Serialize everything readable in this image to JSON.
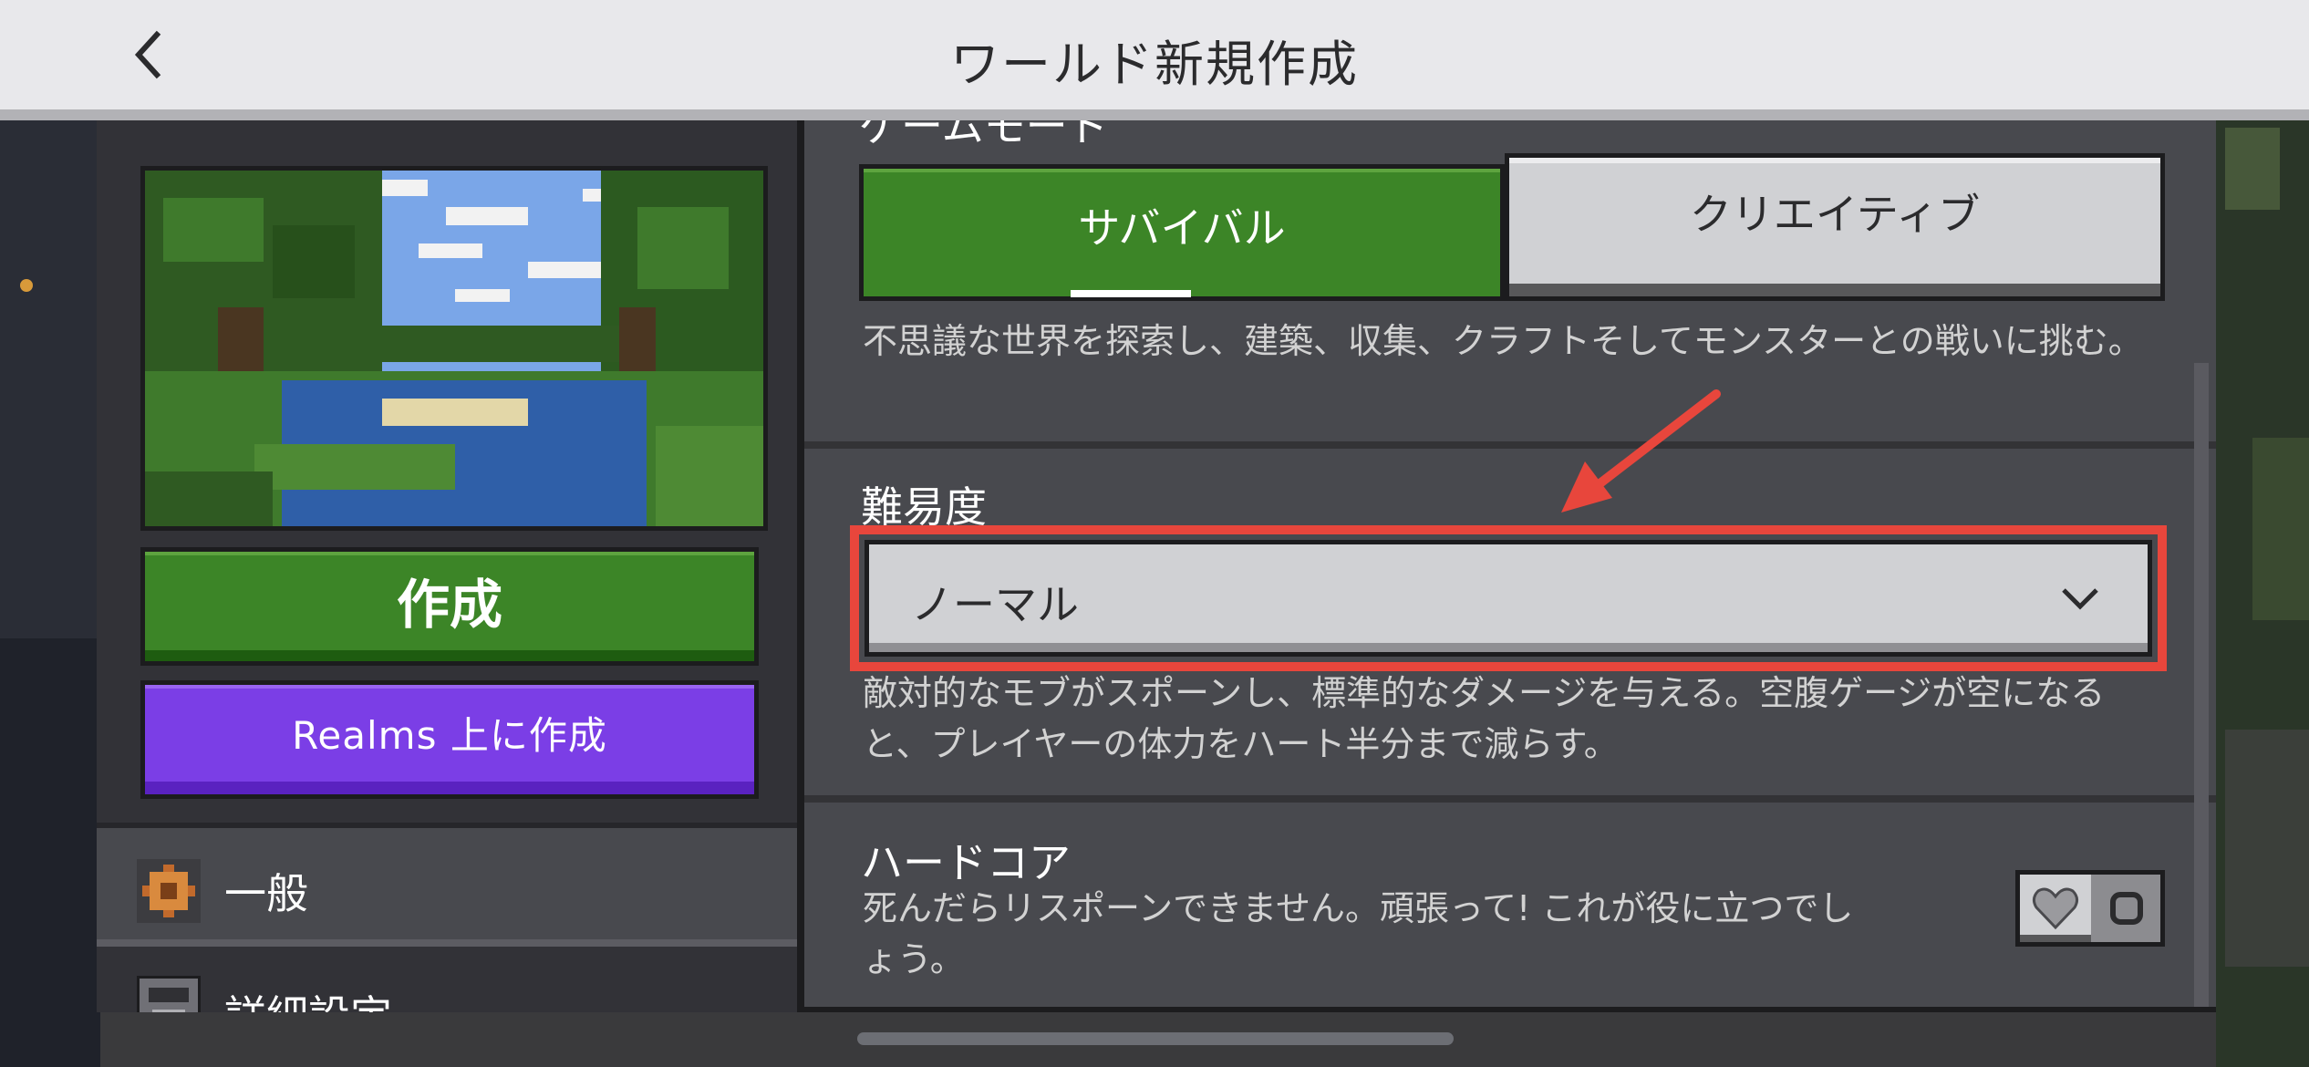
{
  "header": {
    "title": "ワールド新規作成"
  },
  "left": {
    "create_label": "作成",
    "realms_label": "Realms 上に作成",
    "nav": [
      {
        "label": "一般",
        "icon": "gear-icon",
        "selected": true
      },
      {
        "label": "詳細設定",
        "icon": "settings-block-icon",
        "selected": false
      }
    ]
  },
  "right": {
    "game_mode": {
      "label_clipped": "ゲームモード",
      "options": [
        "サバイバル",
        "クリエイティブ"
      ],
      "selected": "サバイバル",
      "description": "不思議な世界を探索し、建築、収集、クラフトそしてモンスターとの戦いに挑む。"
    },
    "difficulty": {
      "label": "難易度",
      "value": "ノーマル",
      "description": "敵対的なモブがスポーンし、標準的なダメージを与える。空腹ゲージが空になると、プレイヤーの体力をハート半分まで減らす。"
    },
    "hardcore": {
      "label": "ハードコア",
      "description": "死んだらリスポーンできません。頑張って! これが役に立つでしょう。",
      "enabled": false
    }
  },
  "colors": {
    "accent_green": "#3c8527",
    "realms_purple": "#7b3ee6",
    "highlight_red": "#e8463c"
  }
}
